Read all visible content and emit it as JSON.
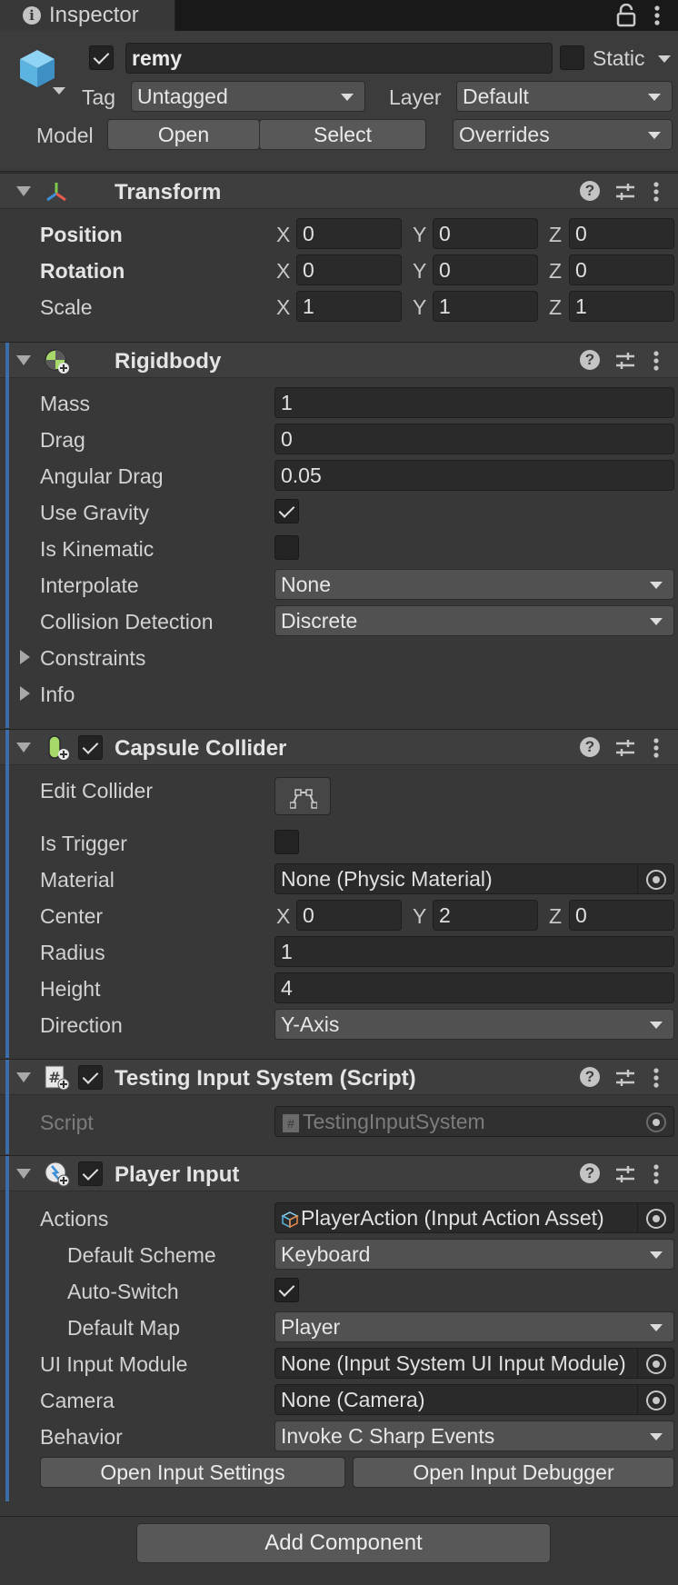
{
  "tab": {
    "title": "Inspector"
  },
  "gameobject": {
    "active": true,
    "name": "remy",
    "static_label": "Static",
    "static_checked": false,
    "tag_label": "Tag",
    "tag_value": "Untagged",
    "layer_label": "Layer",
    "layer_value": "Default",
    "model_label": "Model",
    "open_label": "Open",
    "select_label": "Select",
    "overrides_label": "Overrides"
  },
  "transform": {
    "title": "Transform",
    "rows": [
      {
        "label": "Position",
        "x": "0",
        "y": "0",
        "z": "0"
      },
      {
        "label": "Rotation",
        "x": "0",
        "y": "0",
        "z": "0"
      },
      {
        "label": "Scale",
        "x": "1",
        "y": "1",
        "z": "1"
      }
    ]
  },
  "axis": {
    "x": "X",
    "y": "Y",
    "z": "Z"
  },
  "rigidbody": {
    "title": "Rigidbody",
    "mass_label": "Mass",
    "mass": "1",
    "drag_label": "Drag",
    "drag": "0",
    "angular_drag_label": "Angular Drag",
    "angular_drag": "0.05",
    "use_gravity_label": "Use Gravity",
    "use_gravity": true,
    "is_kinematic_label": "Is Kinematic",
    "is_kinematic": false,
    "interpolate_label": "Interpolate",
    "interpolate": "None",
    "collision_label": "Collision Detection",
    "collision": "Discrete",
    "constraints_label": "Constraints",
    "info_label": "Info"
  },
  "capsule": {
    "title": "Capsule Collider",
    "enabled": true,
    "edit_collider_label": "Edit Collider",
    "is_trigger_label": "Is Trigger",
    "is_trigger": false,
    "material_label": "Material",
    "material": "None (Physic Material)",
    "center_label": "Center",
    "center_x": "0",
    "center_y": "2",
    "center_z": "0",
    "radius_label": "Radius",
    "radius": "1",
    "height_label": "Height",
    "height": "4",
    "direction_label": "Direction",
    "direction": "Y-Axis"
  },
  "testing_script": {
    "title": "Testing Input System (Script)",
    "enabled": true,
    "script_label": "Script",
    "script_value": "TestingInputSystem"
  },
  "player_input": {
    "title": "Player Input",
    "enabled": true,
    "actions_label": "Actions",
    "actions": "PlayerAction (Input Action Asset)",
    "default_scheme_label": "Default Scheme",
    "default_scheme": "Keyboard",
    "auto_switch_label": "Auto-Switch",
    "auto_switch": true,
    "default_map_label": "Default Map",
    "default_map": "Player",
    "ui_module_label": "UI Input Module",
    "ui_module": "None (Input System UI Input Module)",
    "camera_label": "Camera",
    "camera": "None (Camera)",
    "behavior_label": "Behavior",
    "behavior": "Invoke C Sharp Events",
    "open_settings_label": "Open Input Settings",
    "open_debugger_label": "Open Input Debugger"
  },
  "add_component_label": "Add Component",
  "colors": {
    "background": "#383838",
    "field": "#2a2a2a",
    "accent_bar": "#3d6da8"
  }
}
